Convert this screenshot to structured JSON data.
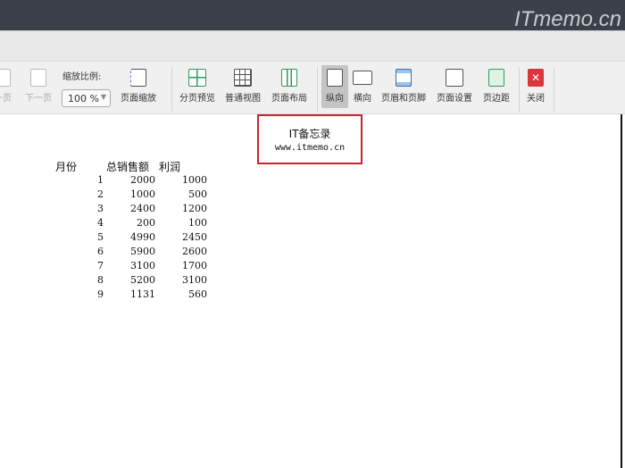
{
  "watermark": "ITmemo.cn",
  "toolbar": {
    "prev_page": "一页",
    "next_page": "下一页",
    "zoom_label": "缩放比例:",
    "zoom_value": "100 %",
    "page_zoom": "页面缩放",
    "page_break_preview": "分页预览",
    "normal_view": "普通视图",
    "page_layout": "页面布局",
    "portrait": "纵向",
    "landscape": "横向",
    "header_footer": "页眉和页脚",
    "page_setup": "页面设置",
    "margins": "页边距",
    "close": "关闭"
  },
  "page_header": {
    "line1": "IT备忘录",
    "line2": "www.itmemo.cn",
    "border_color": "#c8262c"
  },
  "table": {
    "headers": [
      "月份",
      "总销售额",
      "利润"
    ],
    "rows": [
      [
        "1",
        "2000",
        "1000"
      ],
      [
        "2",
        "1000",
        "500"
      ],
      [
        "3",
        "2400",
        "1200"
      ],
      [
        "4",
        "200",
        "100"
      ],
      [
        "5",
        "4990",
        "2450"
      ],
      [
        "6",
        "5900",
        "2600"
      ],
      [
        "7",
        "3100",
        "1700"
      ],
      [
        "8",
        "5200",
        "3100"
      ],
      [
        "9",
        "1131",
        "560"
      ]
    ]
  }
}
